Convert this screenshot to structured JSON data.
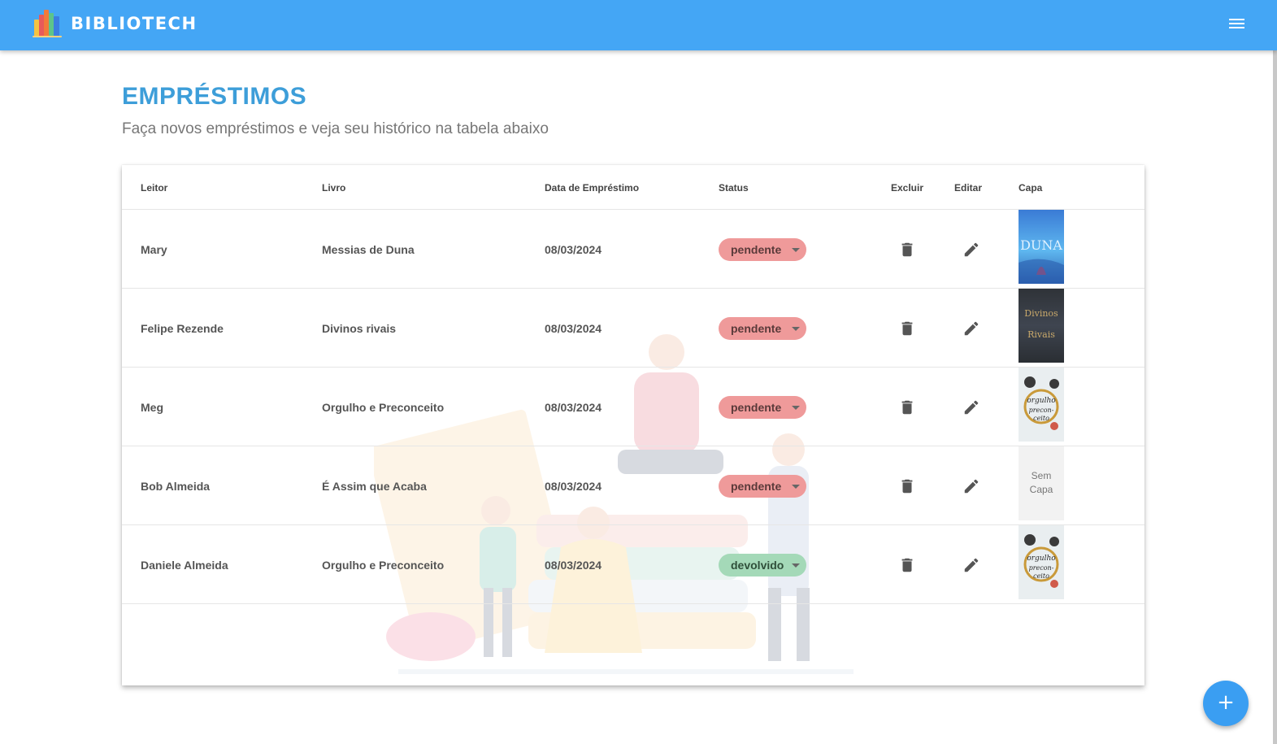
{
  "app": {
    "name": "BIBLIOTECH",
    "logo_icon": "books-logo-icon"
  },
  "header": {
    "menu_icon": "hamburger-menu-icon"
  },
  "page": {
    "title": "EMPRÉSTIMOS",
    "subtitle": "Faça novos empréstimos e veja seu histórico na tabela abaixo"
  },
  "table": {
    "columns": [
      "Leitor",
      "Livro",
      "Data de Empréstimo",
      "Status",
      "Excluir",
      "Editar",
      "Capa"
    ],
    "rows": [
      {
        "leitor": "Mary",
        "livro": "Messias de Duna",
        "data": "08/03/2024",
        "status": "pendente",
        "capa": "cover-duna"
      },
      {
        "leitor": "Felipe Rezende",
        "livro": "Divinos rivais",
        "data": "08/03/2024",
        "status": "pendente",
        "capa": "cover-divinos-rivais"
      },
      {
        "leitor": "Meg",
        "livro": "Orgulho e Preconceito",
        "data": "08/03/2024",
        "status": "pendente",
        "capa": "cover-orgulho"
      },
      {
        "leitor": "Bob Almeida",
        "livro": "É Assim que Acaba",
        "data": "08/03/2024",
        "status": "pendente",
        "capa": "none",
        "sem_capa_1": "Sem",
        "sem_capa_2": "Capa"
      },
      {
        "leitor": "Daniele Almeida",
        "livro": "Orgulho e Preconceito",
        "data": "08/03/2024",
        "status": "devolvido",
        "capa": "cover-orgulho"
      }
    ],
    "delete_icon": "trash-icon",
    "edit_icon": "pencil-icon"
  },
  "covers": {
    "duna_text": "DUNA",
    "divinos_line1": "Divinos",
    "divinos_line2": "Rivais",
    "orgulho_line1": "orgulho",
    "orgulho_line2": "precon-",
    "orgulho_line3": "ceito"
  },
  "fab": {
    "label": "+",
    "icon": "add-icon"
  },
  "colors": {
    "header": "#44a6f5",
    "title": "#3d9ed9",
    "pendente": "#ef9a9a",
    "devolvido": "#a4d9b8",
    "fab": "#3a9ef2"
  }
}
